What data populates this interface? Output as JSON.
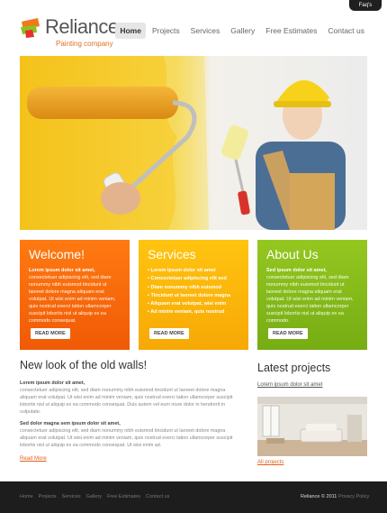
{
  "header": {
    "faq_label": "Faq's",
    "brand_name": "Reliance",
    "tagline": "Painting company"
  },
  "nav": {
    "items": [
      {
        "label": "Home"
      },
      {
        "label": "Projects"
      },
      {
        "label": "Services"
      },
      {
        "label": "Gallery"
      },
      {
        "label": "Free Estimates"
      },
      {
        "label": "Contact us"
      }
    ]
  },
  "boxes": {
    "welcome": {
      "title": "Welcome!",
      "lead": "Lorem ipsum dolor sit amet,",
      "body": "consectetuer adipiscing elit, sed diam nonummy nibh euismod tincidunt ut laoreet dolore magna aliquam erat volutpat. Ut wisi enim ad minim veniam, quis nostrud exerci tation ullamcorper suscipit lobortis nisl ut aliquip ex ea commodo consequat.",
      "more": "READ MORE"
    },
    "services": {
      "title": "Services",
      "items": [
        "Lorem ipsum dolor sit amet",
        "Consectetuer adipiscing elit sed",
        "Diam nonummy nibh euismod",
        "Tincidunt ut laoreet dolore magna",
        "Aliquam erat volutpat, wisi enim",
        "Ad minim veniam, quis nostrud"
      ],
      "more": "READ MORE"
    },
    "about": {
      "title": "About Us",
      "lead": "Sed ipsum dolor sit amet,",
      "body": "consectetuer adipiscing elit, sed diam nonummy nibh euismod tincidunt ut laoreet dolore magna aliquam erat volutpat. Ut wisi enim ad minim veniam, quis nostrud exerci tation ullamcorper suscipit lobortis nisl ut aliquip ex ea commodo.",
      "more": "READ MORE"
    }
  },
  "content": {
    "title": "New look of the old walls!",
    "p1_head": "Lorem ipsum dolor sit amet,",
    "p1_body": "consectetuer adipiscing elit, sed diam nonummy nibh euismod tincidunt ut laoreet dolore magna aliquam erat volutpat. Ut wisi enim ad minim veniam, quis nostrud exerci tation ullamcorper suscipit lobortis nisl ut aliquip ex ea commodo consequat. Duis autem vel eum iriure dolor in hendrerit in vulputate.",
    "p2_head": "Sed dolor magna sem ipsum dolor sit amet,",
    "p2_body": "consectetuer adipiscing elit, sed diam nonummy nibh euismod tincidunt ut laoreet dolore magna aliquam erat volutpat. Ut wisi enim ad minim veniam, quis nostrud exerci tation ullamcorper suscipit lobortis nisl ut aliquip ex ea commodo consequat. Ut wisi enim ad.",
    "read_more": "Read More"
  },
  "latest": {
    "title": "Latest projects",
    "link": "Lorem ipsum dolor sit amet",
    "all": "All projects"
  },
  "footer": {
    "nav": [
      {
        "label": "Home"
      },
      {
        "label": "Projects"
      },
      {
        "label": "Services"
      },
      {
        "label": "Gallery"
      },
      {
        "label": "Free Estimates"
      },
      {
        "label": "Contact us"
      }
    ],
    "copyright": "Reliance © 2011",
    "privacy": "Privacy Policy"
  },
  "colors": {
    "orange": "#f36a0a",
    "yellow": "#fbb60b",
    "green": "#86bb1a",
    "footer": "#1d1d1d",
    "accent_link": "#e0621a"
  }
}
